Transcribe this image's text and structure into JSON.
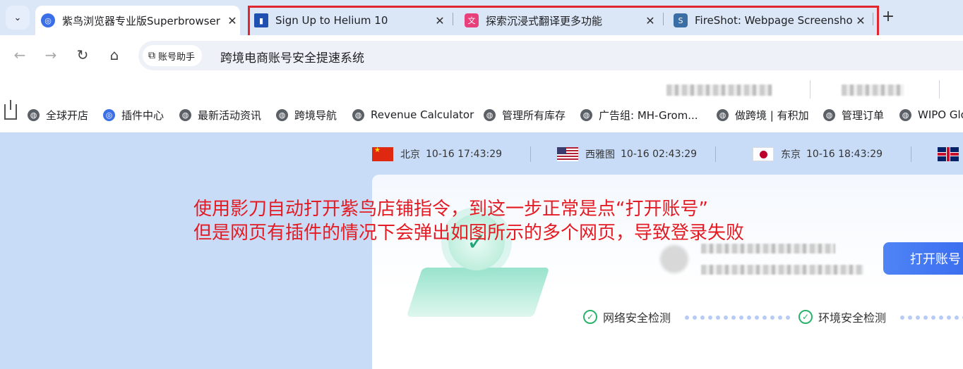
{
  "tabs": [
    {
      "title": "紫鸟浏览器专业版Superbrowser",
      "icon": "ziniao-icon",
      "active": true
    },
    {
      "title": "Sign Up to Helium 10",
      "icon": "helium10-icon"
    },
    {
      "title": "探索沉浸式翻译更多功能",
      "icon": "immersive-translate-icon"
    },
    {
      "title": "FireShot: Webpage Screenshot",
      "icon": "fireshot-icon"
    }
  ],
  "tab_close": "✕",
  "new_tab": "+",
  "address": {
    "chip_label": "账号助手",
    "url": "跨境电商账号安全提速系统"
  },
  "bookmarks": [
    {
      "label": "全球开店"
    },
    {
      "label": "插件中心"
    },
    {
      "label": "最新活动资讯"
    },
    {
      "label": "跨境导航"
    },
    {
      "label": "Revenue Calculator"
    },
    {
      "label": "管理所有库存"
    },
    {
      "label": "广告组: MH-Grom..."
    },
    {
      "label": "做跨境 | 有积加"
    },
    {
      "label": "管理订单"
    },
    {
      "label": "WIPO Glo"
    }
  ],
  "clocks": [
    {
      "city": "北京",
      "time": "10-16 17:43:29"
    },
    {
      "city": "西雅图",
      "time": "10-16 02:43:29"
    },
    {
      "city": "东京",
      "time": "10-16 18:43:29"
    }
  ],
  "card": {
    "open_button": "打开账号",
    "steps": [
      "网络安全检测",
      "环境安全检测"
    ]
  },
  "annotation": {
    "line1": "使用影刀自动打开紫鸟店铺指令，到这一步正常是点“打开账号”",
    "line2": "但是网页有插件的情况下会弹出如图所示的多个网页，导致登录失败"
  },
  "colors": {
    "annotation": "#e41b23",
    "button": "#3c6ff0",
    "check": "#2bb36b"
  }
}
